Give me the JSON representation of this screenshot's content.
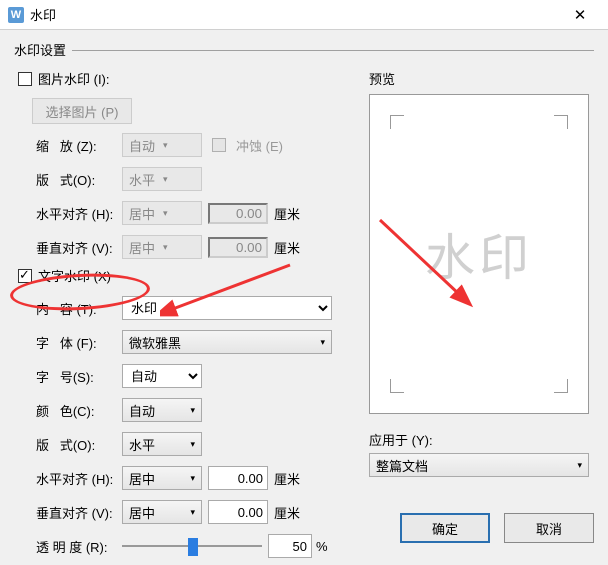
{
  "window": {
    "title": "水印"
  },
  "settings_label": "水印设置",
  "picture_wm": {
    "label": "图片水印 (I):",
    "select_btn": "选择图片 (P)",
    "scale_label": "缩   放 (Z):",
    "scale_value": "自动",
    "washout_label": "冲蚀 (E)",
    "layout_label": "版   式(O):",
    "layout_value": "水平",
    "halign_label": "水平对齐 (H):",
    "halign_value": "居中",
    "halign_num": "0.00",
    "valign_label": "垂直对齐 (V):",
    "valign_value": "居中",
    "valign_num": "0.00",
    "unit": "厘米"
  },
  "text_wm": {
    "label": "文字水印 (X)",
    "content_label": "内   容 (T):",
    "content_value": "水印",
    "font_label": "字   体 (F):",
    "font_value": "微软雅黑",
    "size_label": "字   号(S):",
    "size_value": "自动",
    "color_label": "颜   色(C):",
    "color_value": "自动",
    "layout_label": "版   式(O):",
    "layout_value": "水平",
    "halign_label": "水平对齐 (H):",
    "halign_value": "居中",
    "halign_num": "0.00",
    "valign_label": "垂直对齐 (V):",
    "valign_value": "居中",
    "valign_num": "0.00",
    "trans_label": "透 明 度 (R):",
    "trans_value": "50",
    "trans_unit": "%",
    "unit": "厘米"
  },
  "preview_label": "预览",
  "preview_text": "水印",
  "apply_label": "应用于 (Y):",
  "apply_value": "整篇文档",
  "ok": "确定",
  "cancel": "取消"
}
